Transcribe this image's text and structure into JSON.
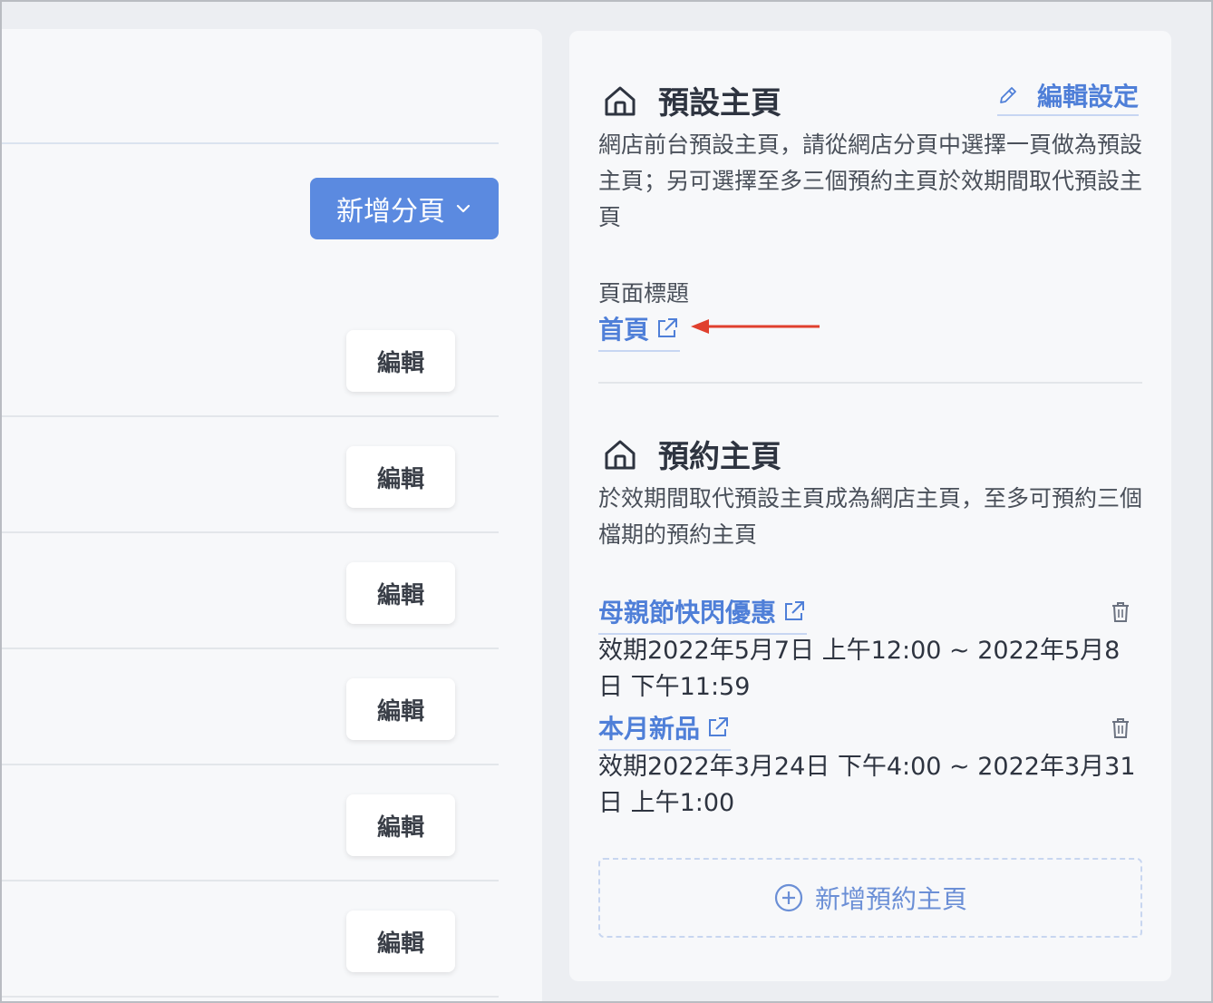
{
  "left": {
    "add_page_label": "新增分頁",
    "rows": [
      {
        "edit_label": "編輯"
      },
      {
        "edit_label": "編輯"
      },
      {
        "edit_label": "編輯"
      },
      {
        "edit_label": "編輯"
      },
      {
        "edit_label": "編輯"
      },
      {
        "edit_label": "編輯"
      }
    ]
  },
  "default_home": {
    "title": "預設主頁",
    "edit_settings_label": "編輯設定",
    "description": "網店前台預設主頁，請從網店分頁中選擇一頁做為預設主頁；另可選擇至多三個預約主頁於效期間取代預設主頁",
    "page_title_label": "頁面標題",
    "page_link": "首頁"
  },
  "scheduled_home": {
    "title": "預約主頁",
    "description": "於效期間取代預設主頁成為網店主頁，至多可預約三個檔期的預約主頁",
    "items": [
      {
        "name": "母親節快閃優惠",
        "validity": "效期2022年5月7日 上午12:00 ~ 2022年5月8日 下午11:59"
      },
      {
        "name": "本月新品",
        "validity": "效期2022年3月24日 下午4:00 ~ 2022年3月31日 上午1:00"
      }
    ],
    "add_label": "新增預約主頁"
  },
  "colors": {
    "accent": "#4f7fd8",
    "button_blue": "#5b8ae0",
    "arrow_red": "#e0402e"
  }
}
